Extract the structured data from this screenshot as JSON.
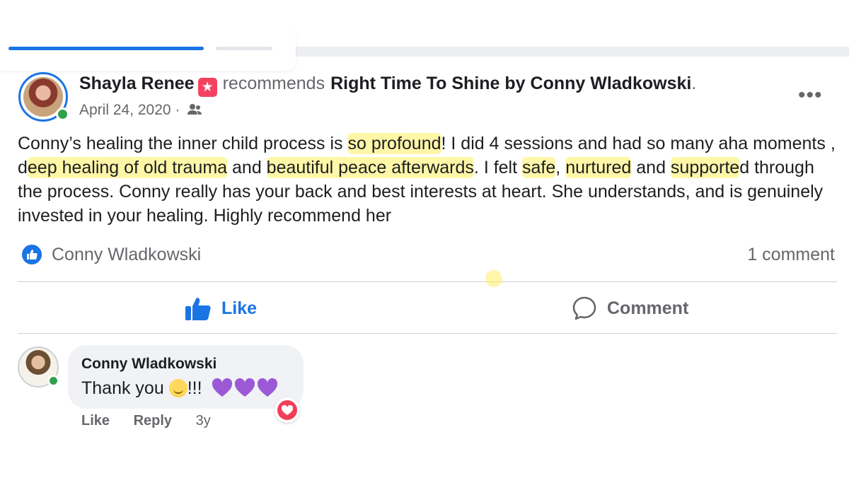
{
  "post": {
    "author": "Shayla Renee",
    "recommend_verb": "recommends",
    "page_name": "Right Time To Shine by Conny Wladkowski",
    "page_name_suffix": ".",
    "date": "April 24, 2020",
    "date_separator": "·",
    "audience_icon": "friends-icon",
    "more_label": "•••",
    "text_segments": [
      {
        "text": "Conny’s healing the inner child process is ",
        "highlight": false
      },
      {
        "text": "so profound",
        "highlight": true
      },
      {
        "text": "! I did 4 sessions and had so many aha moments , d",
        "highlight": false
      },
      {
        "text": "eep healing of old trauma",
        "highlight": true
      },
      {
        "text": " and ",
        "highlight": false
      },
      {
        "text": "beautiful peace afterwards",
        "highlight": true
      },
      {
        "text": ". I felt ",
        "highlight": false
      },
      {
        "text": "safe",
        "highlight": true
      },
      {
        "text": ", ",
        "highlight": false
      },
      {
        "text": "nurtured",
        "highlight": true
      },
      {
        "text": " and ",
        "highlight": false
      },
      {
        "text": "supporte",
        "highlight": true
      },
      {
        "text": "d through the process. Conny really has your back and best interests at heart. She understands, and is genuinely invested in your healing. Highly recommend her",
        "highlight": false
      }
    ],
    "highlight_color": "#fff26e"
  },
  "reactions": {
    "icon": "like-icon",
    "name": "Conny Wladkowski",
    "comment_count": "1 comment"
  },
  "actions": {
    "like_label": "Like",
    "comment_label": "Comment",
    "accent_color": "#1b74e4"
  },
  "comment": {
    "author": "Conny Wladkowski",
    "text": "Thank you",
    "exclaim": "!!!",
    "emoji_icon": "smiling-face-icon",
    "hearts_icon": "purple-hearts-icon",
    "reaction_icon": "heart-reaction-icon",
    "like_label": "Like",
    "reply_label": "Reply",
    "time": "3y"
  }
}
